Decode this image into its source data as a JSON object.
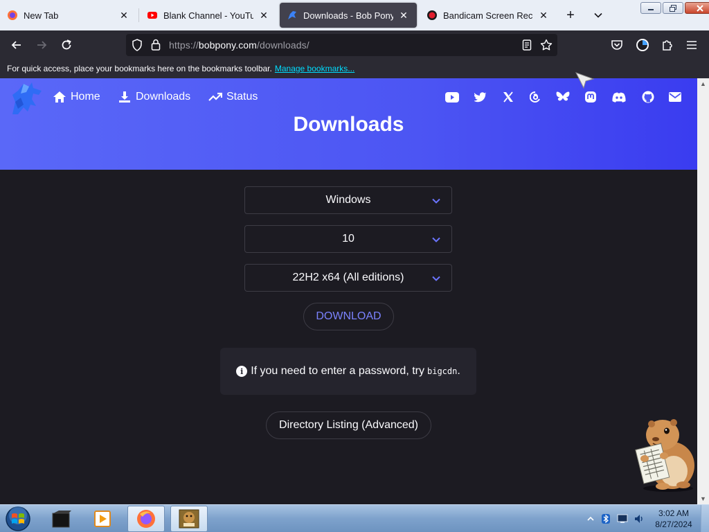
{
  "browser": {
    "tabs": [
      {
        "title": "New Tab",
        "icon": "firefox-icon",
        "active": false
      },
      {
        "title": "Blank Channel - YouTube",
        "icon": "youtube-icon",
        "active": false
      },
      {
        "title": "Downloads - Bob Pony",
        "icon": "bobpony-icon",
        "active": true
      },
      {
        "title": "Bandicam Screen Recorder",
        "icon": "bandicam-icon",
        "active": false
      }
    ],
    "new_tab_glyph": "+",
    "tab_close_glyph": "✕",
    "url": {
      "host": "bobpony.com",
      "prefix": "https://",
      "path": "/downloads/"
    },
    "bookmarks_bar": {
      "message": "For quick access, place your bookmarks here on the bookmarks toolbar.",
      "link": "Manage bookmarks..."
    }
  },
  "site": {
    "nav": [
      {
        "label": "Home",
        "icon": "home-icon"
      },
      {
        "label": "Downloads",
        "icon": "download-icon"
      },
      {
        "label": "Status",
        "icon": "trending-up-icon"
      }
    ],
    "social": [
      "youtube-icon",
      "twitter-icon",
      "x-icon",
      "threads-icon",
      "bluesky-icon",
      "mastodon-icon",
      "discord-icon",
      "github-icon",
      "mail-icon"
    ],
    "hero_title": "Downloads",
    "selects": {
      "os": "Windows",
      "version": "10",
      "build": "22H2 x64 (All editions)"
    },
    "download_label": "DOWNLOAD",
    "notice": {
      "text": "If you need to enter a password, try",
      "code": "bigcdn",
      "end": "."
    },
    "directory_label": "Directory Listing (Advanced)",
    "colors": {
      "hero": "#4c55f3",
      "accent": "#7b83ff",
      "page_bg": "#1c1b22"
    }
  },
  "taskbar": {
    "items": [
      "terminal-icon",
      "media-player-icon",
      "firefox-icon",
      "bonzi-icon"
    ],
    "clock_time": "3:02 AM",
    "clock_date": "8/27/2024"
  }
}
